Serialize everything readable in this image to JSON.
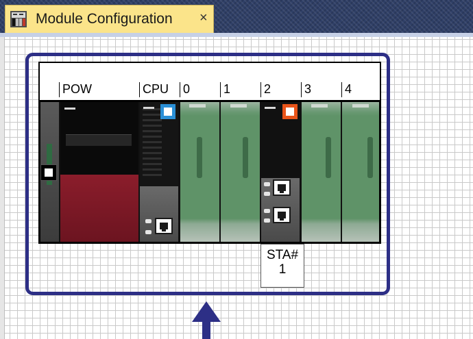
{
  "tab": {
    "title": "Module Configuration",
    "close_glyph": "×",
    "icon": "module-configuration-icon"
  },
  "rack": {
    "slot_headers": [
      "POW",
      "CPU",
      "0",
      "1",
      "2",
      "3",
      "4"
    ],
    "station_label": "STA#\n1"
  },
  "colors": {
    "tab_active": "#fbe48a",
    "selection_border": "#2d2f86",
    "cpu_indicator": "#2a8fd6",
    "station_indicator": "#e8541a",
    "io_module_green": "#5f9368",
    "power_red": "#8b1d2b"
  }
}
